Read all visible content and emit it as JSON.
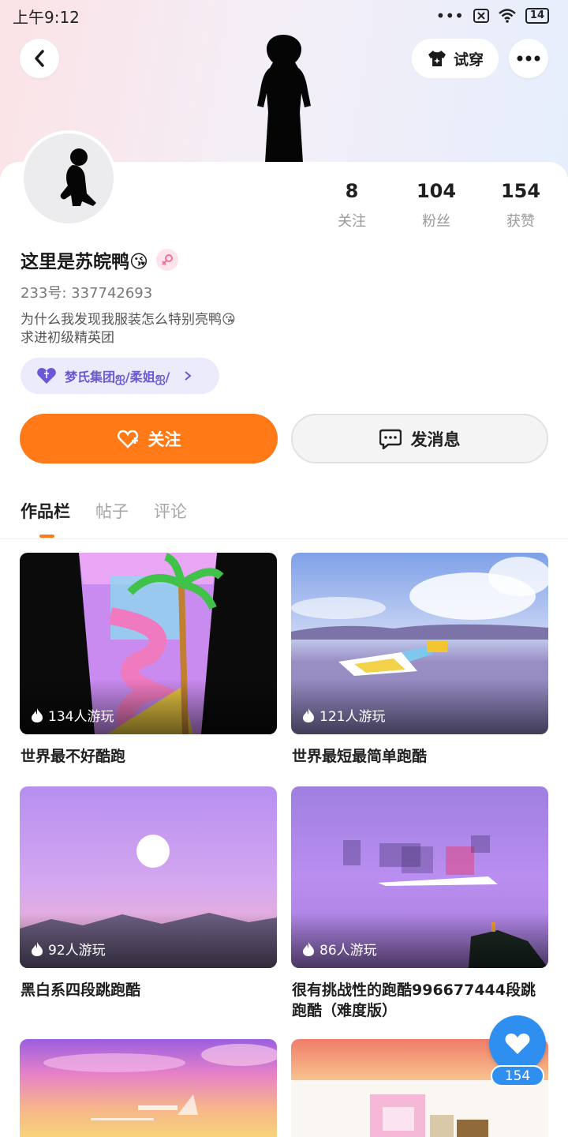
{
  "status_bar": {
    "time": "上午9:12",
    "battery": "14"
  },
  "header": {
    "tryon_label": "试穿"
  },
  "profile": {
    "nickname": "这里是苏皖鸭😘",
    "uid": "233号: 337742693",
    "bio_line1": "为什么我发现我服装怎么特别亮鸭😘",
    "bio_line2": "求进初级精英团",
    "group": "梦氏集团ஐ/柔姐ஐ/",
    "stats": [
      {
        "value": "8",
        "label": "关注"
      },
      {
        "value": "104",
        "label": "粉丝"
      },
      {
        "value": "154",
        "label": "获赞"
      }
    ]
  },
  "actions": {
    "follow": "关注",
    "message": "发消息"
  },
  "tabs": [
    "作品栏",
    "帖子",
    "评论"
  ],
  "works": [
    {
      "plays": "134人游玩",
      "title": "世界最不好酷跑"
    },
    {
      "plays": "121人游玩",
      "title": "世界最短最简单跑酷"
    },
    {
      "plays": "92人游玩",
      "title": "黑白系四段跳跑酷"
    },
    {
      "plays": "86人游玩",
      "title": "很有挑战性的跑酷996677444段跳跑酷（难度版）"
    }
  ],
  "like_fab": {
    "count": "154"
  },
  "colors": {
    "accent": "#ff7a17",
    "like": "#2f8ff0",
    "group": "#6b58d6"
  }
}
